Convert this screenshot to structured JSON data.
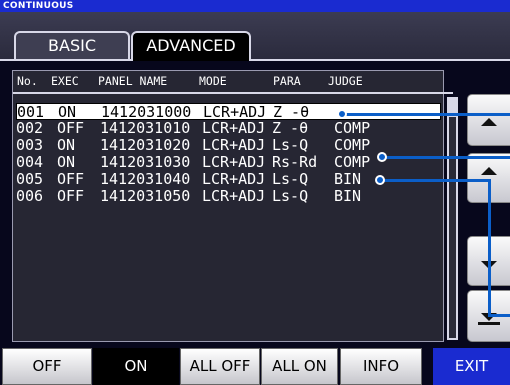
{
  "window": {
    "title": "CONTINUOUS"
  },
  "tabs": [
    {
      "label": "BASIC"
    },
    {
      "label": "ADVANCED"
    }
  ],
  "table": {
    "headers": [
      "No.",
      "EXEC",
      "PANEL NAME",
      "MODE",
      "PARA",
      "JUDGE"
    ],
    "rows": [
      {
        "no": "001",
        "exec": "ON",
        "panel": "1412031000",
        "mode": "LCR+ADJ",
        "para": "Z -θ",
        "judge": ""
      },
      {
        "no": "002",
        "exec": "OFF",
        "panel": "1412031010",
        "mode": "LCR+ADJ",
        "para": "Z -θ",
        "judge": "COMP"
      },
      {
        "no": "003",
        "exec": "ON",
        "panel": "1412031020",
        "mode": "LCR+ADJ",
        "para": "Ls-Q",
        "judge": "COMP"
      },
      {
        "no": "004",
        "exec": "ON",
        "panel": "1412031030",
        "mode": "LCR+ADJ",
        "para": "Rs-Rd",
        "judge": "COMP"
      },
      {
        "no": "005",
        "exec": "OFF",
        "panel": "1412031040",
        "mode": "LCR+ADJ",
        "para": "Ls-Q",
        "judge": "BIN"
      },
      {
        "no": "006",
        "exec": "OFF",
        "panel": "1412031050",
        "mode": "LCR+ADJ",
        "para": "Ls-Q",
        "judge": "BIN"
      }
    ]
  },
  "side_buttons": {
    "page_up_icon": "double-up-arrow-icon",
    "up_icon": "up-arrow-icon",
    "down_icon": "down-arrow-icon",
    "page_down_icon": "double-down-arrow-icon"
  },
  "bottom_buttons": [
    "OFF",
    "ON",
    "ALL OFF",
    "ALL ON",
    "INFO",
    "EXIT"
  ],
  "colors": {
    "accent": "#1a2bd0",
    "connector": "#0b5ec8"
  }
}
